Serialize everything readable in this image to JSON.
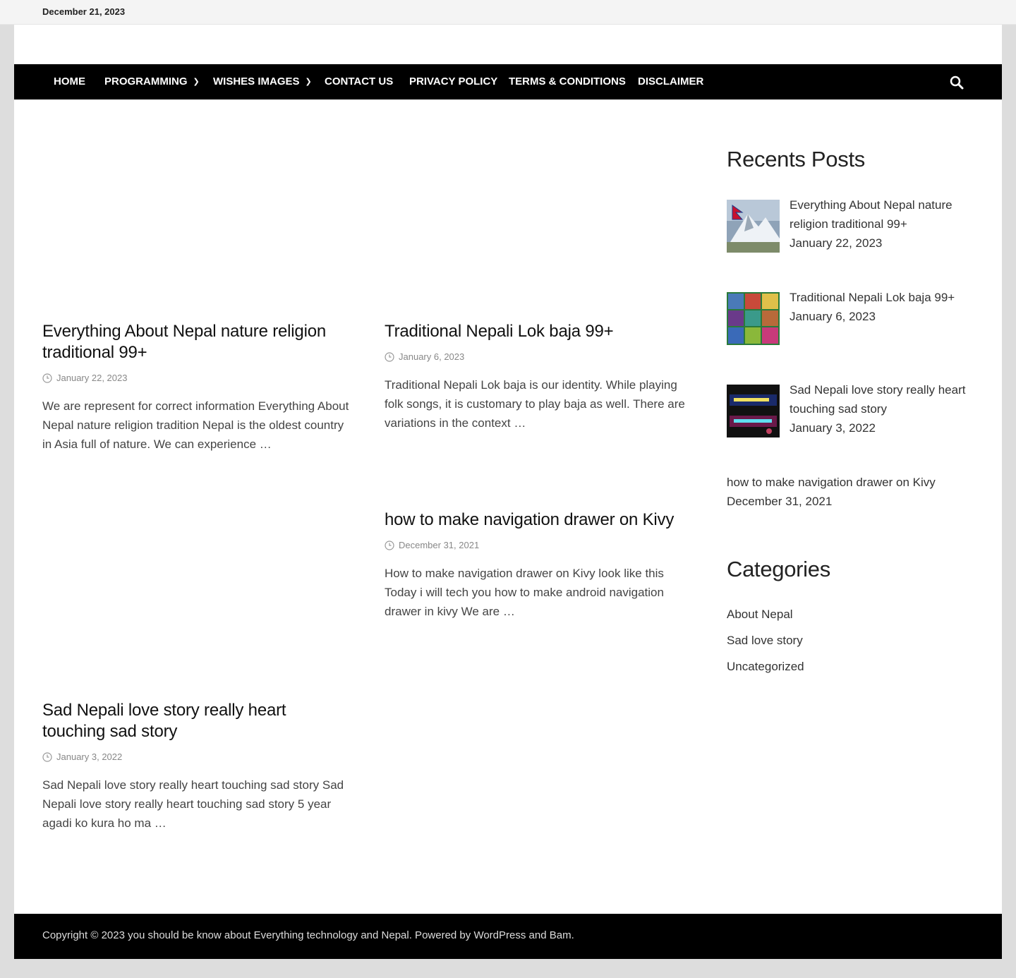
{
  "topbar": {
    "date": "December 21, 2023"
  },
  "nav": {
    "items": [
      {
        "label": "Home"
      },
      {
        "label": "Programming"
      },
      {
        "label": "Wishes Images"
      },
      {
        "label": "Contact Us"
      },
      {
        "label": "Privacy Policy"
      },
      {
        "label": "Terms & Conditions"
      },
      {
        "label": "Disclaimer"
      }
    ],
    "search_icon": "search-icon",
    "dropdown_icon": "chevron-down-icon"
  },
  "posts": [
    {
      "title": "Everything About Nepal nature religion traditional 99+",
      "date": "January 22, 2023",
      "excerpt": "We are represent for correct information Everything About Nepal nature religion tradition Nepal is the oldest country in Asia full of nature. We can experience …"
    },
    {
      "title": "Traditional Nepali Lok baja 99+",
      "date": "January 6, 2023",
      "excerpt": "Traditional Nepali Lok baja  is our identity.  While playing folk songs, it is customary to play baja as well.  There are variations in the  context …"
    },
    {
      "title": "how to make navigation drawer on Kivy",
      "date": "December 31, 2021",
      "excerpt": "How to make navigation drawer on Kivy look like this Today i will tech you how to  make android navigation drawer in kivy We are …"
    },
    {
      "title": "Sad Nepali love story really heart touching sad story",
      "date": "January 3, 2022",
      "excerpt": "Sad Nepali love story really heart touching sad story Sad Nepali love story really heart touching sad story 5 year agadi ko kura ho ma …"
    }
  ],
  "sidebar": {
    "recent_title": "Recents Posts",
    "recent": [
      {
        "title": "Everything About Nepal nature religion traditional 99+",
        "date": "January 22, 2023"
      },
      {
        "title": "Traditional Nepali Lok baja 99+",
        "date": "January 6, 2023"
      },
      {
        "title": "Sad Nepali love story really heart touching sad story",
        "date": "January 3, 2022"
      },
      {
        "title": "how to make navigation drawer on Kivy",
        "date": "December 31, 2021"
      }
    ],
    "categories_title": "Categories",
    "categories": [
      "About Nepal",
      "Sad love story",
      "Uncategorized"
    ]
  },
  "footer": {
    "prefix": "Copyright © 2023 you should be know about Everything technology and Nepal. Powered by ",
    "wordpress": "WordPress",
    "and": " and ",
    "bam": "Bam",
    "suffix": "."
  }
}
